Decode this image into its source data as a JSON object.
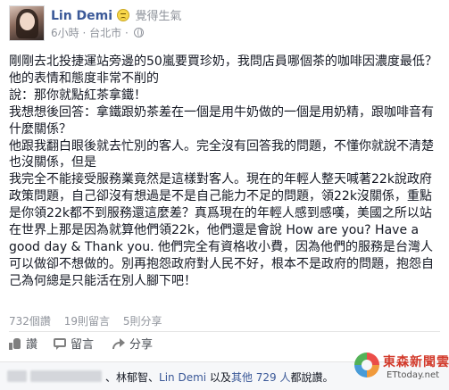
{
  "author": {
    "name": "Lin Demi",
    "feeling": "覺得生氣",
    "time": "6小時",
    "location": "台北市"
  },
  "post": {
    "paragraphs": [
      "剛剛去北投捷運站旁邊的50嵐要買珍奶，我問店員哪個茶的咖啡因濃度最低？他的表情和態度非常不削的",
      "說：那你就點紅茶拿鐵！",
      "我想想後回答：拿鐵跟奶茶差在一個是用牛奶做的一個是用奶精，跟咖啡音有什麼關係？",
      "他跟我翻白眼後就去忙別的客人。完全沒有回答我的問題，不懂你就說不清楚也沒關係，但是",
      "我完全不能接受服務業竟然是這樣對客人。現在的年輕人整天喊著22k說政府政策問題，自己卻沒有想過是不是自己能力不足的問題，領22k沒關係，重點是你領22k都不到服務還這麼差？真爲現在的年輕人感到感嘆，美國之所以站在世界上那是因為就算他們領22k，他們還是會說 How are you? Have a good day & Thank you. 他們完全有資格收小費，因為他們的服務是台灣人可以做卻不想做的。別再抱怨政府對人民不好，根本不是政府的問題，抱怨自己為何總是只能活在別人腳下吧！"
    ]
  },
  "stats": {
    "comments": "732個讚",
    "shares": "19則留言",
    "likes_count": "5則分享"
  },
  "actions": {
    "like": "讚",
    "comment": "留言",
    "share": "分享"
  },
  "likes_bar": {
    "prefix": "、林郁智、",
    "name": "Lin Demi",
    "middle": " 以及",
    "others": "其他 729 人",
    "suffix": "都說讚。"
  },
  "watermark": {
    "name": "東森新聞雲",
    "domain": "ETtoday.net"
  }
}
